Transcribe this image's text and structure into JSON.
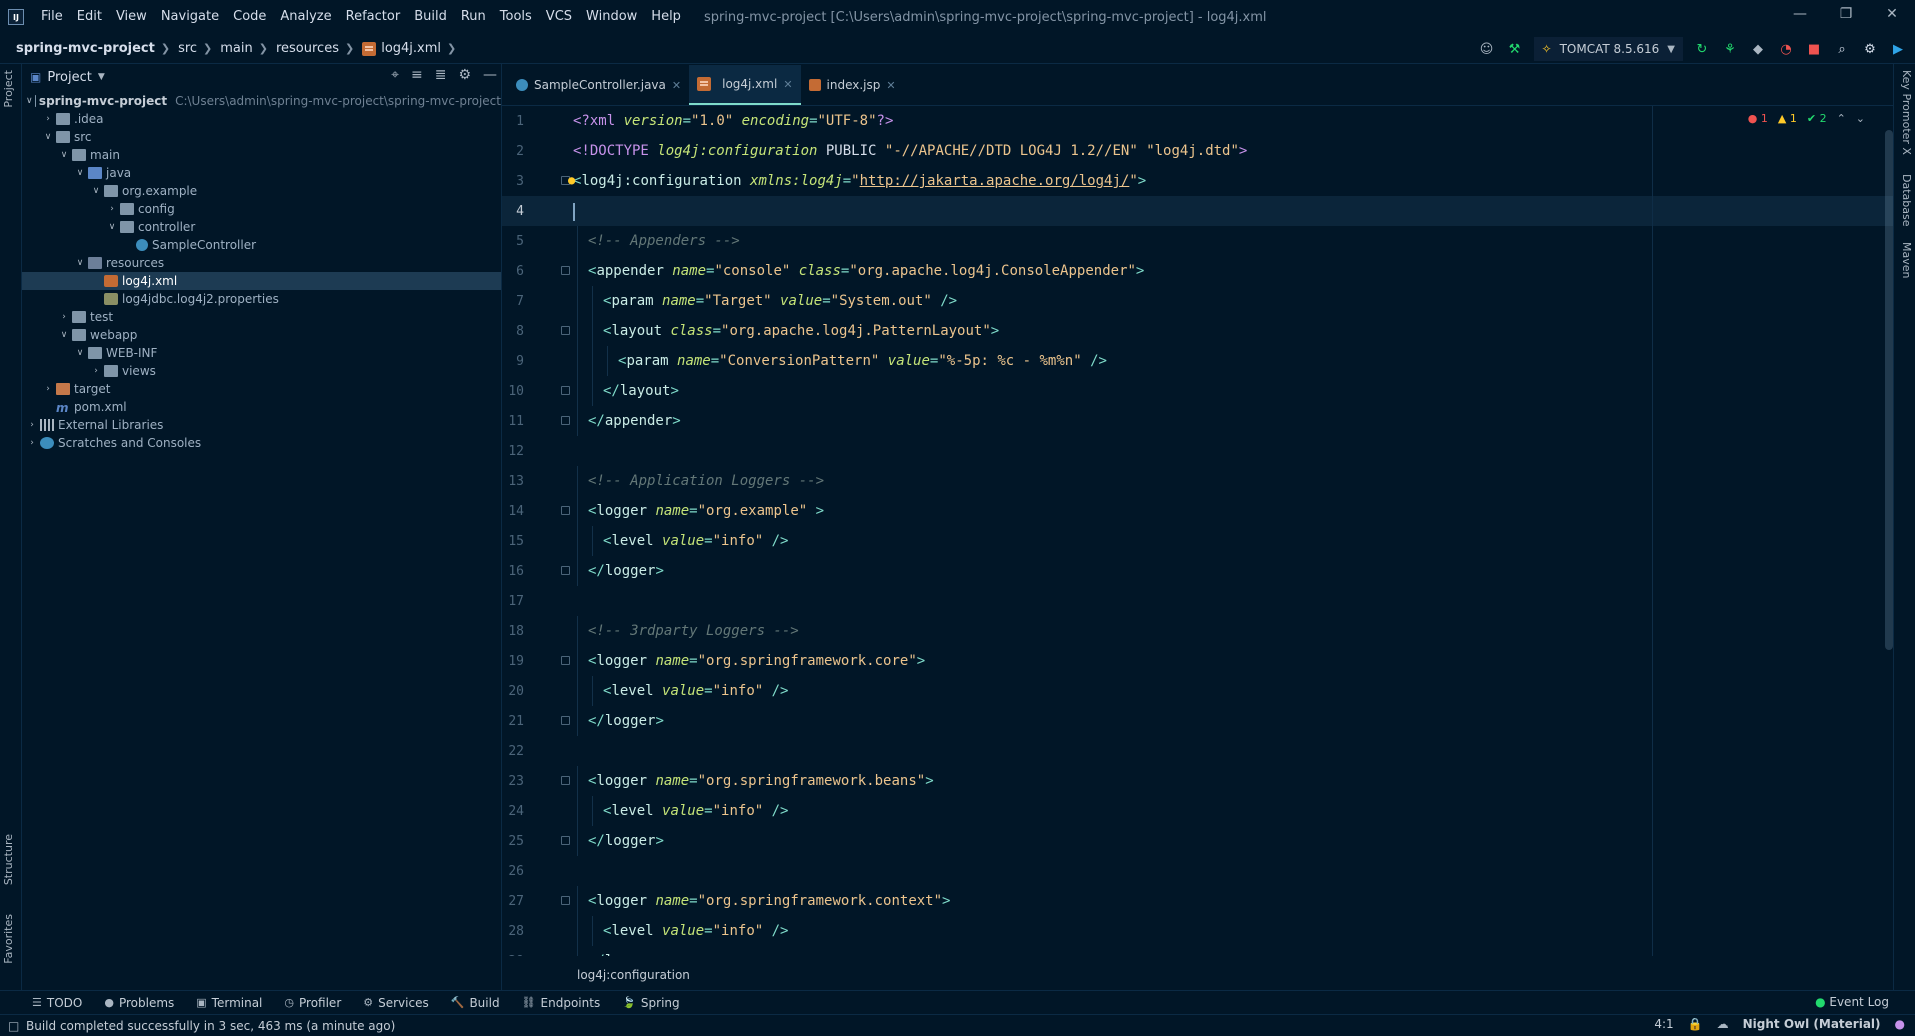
{
  "app": {
    "logo": "IJ",
    "window_title": "spring-mvc-project [C:\\Users\\admin\\spring-mvc-project\\spring-mvc-project] - log4j.xml",
    "menu": [
      "File",
      "Edit",
      "View",
      "Navigate",
      "Code",
      "Analyze",
      "Refactor",
      "Build",
      "Run",
      "Tools",
      "VCS",
      "Window",
      "Help"
    ],
    "window_controls": [
      "—",
      "❐",
      "✕"
    ]
  },
  "navbar": {
    "breadcrumb": [
      "spring-mvc-project",
      "src",
      "main",
      "resources",
      "log4j.xml"
    ],
    "run_config": "TOMCAT 8.5.616"
  },
  "left_strip": {
    "project_tab": "Project",
    "structure_tab": "Structure",
    "favorites_tab": "Favorites"
  },
  "right_strip": {
    "key_promoter": "Key Promoter X",
    "database": "Database",
    "maven": "Maven"
  },
  "project_panel": {
    "title": "Project",
    "tree": [
      {
        "label": "spring-mvc-project",
        "path": "C:\\Users\\admin\\spring-mvc-project\\spring-mvc-project",
        "depth": 0,
        "arrow": "v",
        "icon": "folder"
      },
      {
        "label": ".idea",
        "depth": 1,
        "arrow": ">",
        "icon": "folder"
      },
      {
        "label": "src",
        "depth": 1,
        "arrow": "v",
        "icon": "folder"
      },
      {
        "label": "main",
        "depth": 2,
        "arrow": "v",
        "icon": "folder"
      },
      {
        "label": "java",
        "depth": 3,
        "arrow": "v",
        "icon": "folder-src"
      },
      {
        "label": "org.example",
        "depth": 4,
        "arrow": "v",
        "icon": "folder-pkg"
      },
      {
        "label": "config",
        "depth": 5,
        "arrow": ">",
        "icon": "folder-pkg"
      },
      {
        "label": "controller",
        "depth": 5,
        "arrow": "v",
        "icon": "folder-pkg"
      },
      {
        "label": "SampleController",
        "depth": 6,
        "arrow": "",
        "icon": "class"
      },
      {
        "label": "resources",
        "depth": 3,
        "arrow": "v",
        "icon": "folder-res"
      },
      {
        "label": "log4j.xml",
        "depth": 4,
        "arrow": "",
        "icon": "xml",
        "selected": true
      },
      {
        "label": "log4jdbc.log4j2.properties",
        "depth": 4,
        "arrow": "",
        "icon": "prop"
      },
      {
        "label": "test",
        "depth": 2,
        "arrow": ">",
        "icon": "folder"
      },
      {
        "label": "webapp",
        "depth": 2,
        "arrow": "v",
        "icon": "folder"
      },
      {
        "label": "WEB-INF",
        "depth": 3,
        "arrow": "v",
        "icon": "folder"
      },
      {
        "label": "views",
        "depth": 4,
        "arrow": ">",
        "icon": "folder"
      },
      {
        "label": "target",
        "depth": 1,
        "arrow": ">",
        "icon": "folder-target"
      },
      {
        "label": "pom.xml",
        "depth": 1,
        "arrow": "",
        "icon": "maven"
      },
      {
        "label": "External Libraries",
        "depth": 0,
        "arrow": ">",
        "icon": "lib"
      },
      {
        "label": "Scratches and Consoles",
        "depth": 0,
        "arrow": ">",
        "icon": "scratch"
      }
    ]
  },
  "editor": {
    "tabs": [
      {
        "label": "SampleController.java",
        "icon": "java",
        "active": false
      },
      {
        "label": "log4j.xml",
        "icon": "xml",
        "active": true
      },
      {
        "label": "index.jsp",
        "icon": "jsp",
        "active": false
      }
    ],
    "inspections": {
      "errors": "1",
      "warnings": "1",
      "ok": "2"
    },
    "current_line": 4,
    "lines": [
      {
        "n": 1,
        "fold": false,
        "indent": 0,
        "tokens": [
          [
            "decl",
            "<?xml "
          ],
          [
            "attr",
            "version"
          ],
          [
            "punct",
            "="
          ],
          [
            "str",
            "\"1.0\""
          ],
          [
            "decl",
            " "
          ],
          [
            "attr",
            "encoding"
          ],
          [
            "punct",
            "="
          ],
          [
            "str",
            "\"UTF-8\""
          ],
          [
            "decl",
            "?>"
          ]
        ]
      },
      {
        "n": 2,
        "fold": false,
        "indent": 0,
        "tokens": [
          [
            "decl",
            "<!DOCTYPE "
          ],
          [
            "attr",
            "log4j:configuration"
          ],
          [
            "name",
            " PUBLIC "
          ],
          [
            "str",
            "\"-//APACHE//DTD LOG4J 1.2//EN\""
          ],
          [
            "name",
            " "
          ],
          [
            "str",
            "\"log4j.dtd\""
          ],
          [
            "decl",
            ">"
          ]
        ]
      },
      {
        "n": 3,
        "fold": true,
        "indent": 0,
        "tokens": [
          [
            "bracket",
            "<"
          ],
          [
            "tag",
            "log4j:configuration "
          ],
          [
            "attr",
            "xmlns:log4j"
          ],
          [
            "punct",
            "="
          ],
          [
            "str",
            "\""
          ],
          [
            "url",
            "http://jakarta.apache.org/log4j/"
          ],
          [
            "str",
            "\""
          ],
          [
            "bracket",
            ">"
          ]
        ]
      },
      {
        "n": 4,
        "fold": false,
        "indent": 0,
        "tokens": []
      },
      {
        "n": 5,
        "fold": false,
        "indent": 1,
        "tokens": [
          [
            "comment",
            "<!-- Appenders -->"
          ]
        ]
      },
      {
        "n": 6,
        "fold": true,
        "indent": 1,
        "tokens": [
          [
            "bracket",
            "<"
          ],
          [
            "tag",
            "appender "
          ],
          [
            "attr",
            "name"
          ],
          [
            "punct",
            "="
          ],
          [
            "str",
            "\"console\""
          ],
          [
            "tag",
            " "
          ],
          [
            "attr",
            "class"
          ],
          [
            "punct",
            "="
          ],
          [
            "str",
            "\"org.apache.log4j.ConsoleAppender\""
          ],
          [
            "bracket",
            ">"
          ]
        ]
      },
      {
        "n": 7,
        "fold": false,
        "indent": 2,
        "tokens": [
          [
            "bracket",
            "<"
          ],
          [
            "tag",
            "param "
          ],
          [
            "attr",
            "name"
          ],
          [
            "punct",
            "="
          ],
          [
            "str",
            "\"Target\""
          ],
          [
            "tag",
            " "
          ],
          [
            "attr",
            "value"
          ],
          [
            "punct",
            "="
          ],
          [
            "str",
            "\"System.out\""
          ],
          [
            "tag",
            " "
          ],
          [
            "bracket",
            "/>"
          ]
        ]
      },
      {
        "n": 8,
        "fold": true,
        "indent": 2,
        "tokens": [
          [
            "bracket",
            "<"
          ],
          [
            "tag",
            "layout "
          ],
          [
            "attr",
            "class"
          ],
          [
            "punct",
            "="
          ],
          [
            "str",
            "\"org.apache.log4j.PatternLayout\""
          ],
          [
            "bracket",
            ">"
          ]
        ]
      },
      {
        "n": 9,
        "fold": false,
        "indent": 3,
        "tokens": [
          [
            "bracket",
            "<"
          ],
          [
            "tag",
            "param "
          ],
          [
            "attr",
            "name"
          ],
          [
            "punct",
            "="
          ],
          [
            "str",
            "\"ConversionPattern\""
          ],
          [
            "tag",
            " "
          ],
          [
            "attr",
            "value"
          ],
          [
            "punct",
            "="
          ],
          [
            "str",
            "\"%-5p: %c - %m%n\""
          ],
          [
            "tag",
            " "
          ],
          [
            "bracket",
            "/>"
          ]
        ]
      },
      {
        "n": 10,
        "fold": true,
        "indent": 2,
        "tokens": [
          [
            "bracket",
            "</"
          ],
          [
            "tag",
            "layout"
          ],
          [
            "bracket",
            ">"
          ]
        ]
      },
      {
        "n": 11,
        "fold": true,
        "indent": 1,
        "tokens": [
          [
            "bracket",
            "</"
          ],
          [
            "tag",
            "appender"
          ],
          [
            "bracket",
            ">"
          ]
        ]
      },
      {
        "n": 12,
        "fold": false,
        "indent": 0,
        "tokens": []
      },
      {
        "n": 13,
        "fold": false,
        "indent": 1,
        "tokens": [
          [
            "comment",
            "<!-- Application Loggers -->"
          ]
        ]
      },
      {
        "n": 14,
        "fold": true,
        "indent": 1,
        "tokens": [
          [
            "bracket",
            "<"
          ],
          [
            "tag",
            "logger "
          ],
          [
            "attr",
            "name"
          ],
          [
            "punct",
            "="
          ],
          [
            "str",
            "\"org.example\""
          ],
          [
            "tag",
            " "
          ],
          [
            "bracket",
            ">"
          ]
        ]
      },
      {
        "n": 15,
        "fold": false,
        "indent": 2,
        "tokens": [
          [
            "bracket",
            "<"
          ],
          [
            "tag",
            "level "
          ],
          [
            "attr",
            "value"
          ],
          [
            "punct",
            "="
          ],
          [
            "str",
            "\"info\""
          ],
          [
            "tag",
            " "
          ],
          [
            "bracket",
            "/>"
          ]
        ]
      },
      {
        "n": 16,
        "fold": true,
        "indent": 1,
        "tokens": [
          [
            "bracket",
            "</"
          ],
          [
            "tag",
            "logger"
          ],
          [
            "bracket",
            ">"
          ]
        ]
      },
      {
        "n": 17,
        "fold": false,
        "indent": 0,
        "tokens": []
      },
      {
        "n": 18,
        "fold": false,
        "indent": 1,
        "tokens": [
          [
            "comment",
            "<!-- 3rdparty Loggers -->"
          ]
        ]
      },
      {
        "n": 19,
        "fold": true,
        "indent": 1,
        "tokens": [
          [
            "bracket",
            "<"
          ],
          [
            "tag",
            "logger "
          ],
          [
            "attr",
            "name"
          ],
          [
            "punct",
            "="
          ],
          [
            "str",
            "\"org.springframework.core\""
          ],
          [
            "bracket",
            ">"
          ]
        ]
      },
      {
        "n": 20,
        "fold": false,
        "indent": 2,
        "tokens": [
          [
            "bracket",
            "<"
          ],
          [
            "tag",
            "level "
          ],
          [
            "attr",
            "value"
          ],
          [
            "punct",
            "="
          ],
          [
            "str",
            "\"info\""
          ],
          [
            "tag",
            " "
          ],
          [
            "bracket",
            "/>"
          ]
        ]
      },
      {
        "n": 21,
        "fold": true,
        "indent": 1,
        "tokens": [
          [
            "bracket",
            "</"
          ],
          [
            "tag",
            "logger"
          ],
          [
            "bracket",
            ">"
          ]
        ]
      },
      {
        "n": 22,
        "fold": false,
        "indent": 0,
        "tokens": []
      },
      {
        "n": 23,
        "fold": true,
        "indent": 1,
        "tokens": [
          [
            "bracket",
            "<"
          ],
          [
            "tag",
            "logger "
          ],
          [
            "attr",
            "name"
          ],
          [
            "punct",
            "="
          ],
          [
            "str",
            "\"org.springframework.beans\""
          ],
          [
            "bracket",
            ">"
          ]
        ]
      },
      {
        "n": 24,
        "fold": false,
        "indent": 2,
        "tokens": [
          [
            "bracket",
            "<"
          ],
          [
            "tag",
            "level "
          ],
          [
            "attr",
            "value"
          ],
          [
            "punct",
            "="
          ],
          [
            "str",
            "\"info\""
          ],
          [
            "tag",
            " "
          ],
          [
            "bracket",
            "/>"
          ]
        ]
      },
      {
        "n": 25,
        "fold": true,
        "indent": 1,
        "tokens": [
          [
            "bracket",
            "</"
          ],
          [
            "tag",
            "logger"
          ],
          [
            "bracket",
            ">"
          ]
        ]
      },
      {
        "n": 26,
        "fold": false,
        "indent": 0,
        "tokens": []
      },
      {
        "n": 27,
        "fold": true,
        "indent": 1,
        "tokens": [
          [
            "bracket",
            "<"
          ],
          [
            "tag",
            "logger "
          ],
          [
            "attr",
            "name"
          ],
          [
            "punct",
            "="
          ],
          [
            "str",
            "\"org.springframework.context\""
          ],
          [
            "bracket",
            ">"
          ]
        ]
      },
      {
        "n": 28,
        "fold": false,
        "indent": 2,
        "tokens": [
          [
            "bracket",
            "<"
          ],
          [
            "tag",
            "level "
          ],
          [
            "attr",
            "value"
          ],
          [
            "punct",
            "="
          ],
          [
            "str",
            "\"info\""
          ],
          [
            "tag",
            " "
          ],
          [
            "bracket",
            "/>"
          ]
        ]
      },
      {
        "n": 29,
        "fold": true,
        "indent": 1,
        "tokens": [
          [
            "bracket",
            "</"
          ],
          [
            "tag",
            "logger"
          ],
          [
            "bracket",
            ">"
          ]
        ]
      }
    ],
    "breadcrumb": "log4j:configuration"
  },
  "bottom_tools": [
    "TODO",
    "Problems",
    "Terminal",
    "Profiler",
    "Services",
    "Build",
    "Endpoints",
    "Spring"
  ],
  "bottom_tool_icons": [
    "☰",
    "●",
    "▣",
    "◷",
    "⚙",
    "🔨",
    "⛓",
    "🍃"
  ],
  "event_log": "Event Log",
  "status": {
    "message": "Build completed successfully in 3 sec, 463 ms (a minute ago)",
    "position": "4:1",
    "theme": "Night Owl (Material)"
  },
  "colors": {
    "background": "#011627",
    "accent": "#7fdbca",
    "string": "#ecc48d",
    "attribute": "#c5e478"
  }
}
